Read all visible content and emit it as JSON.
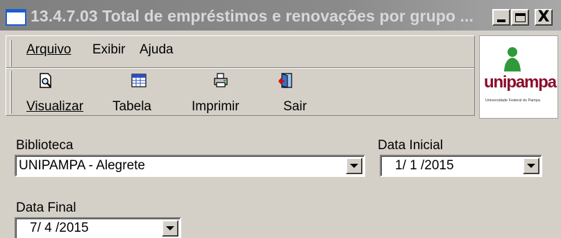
{
  "window": {
    "title": "13.4.7.03 Total de empréstimos e renovações por grupo ...",
    "controls": {
      "minimize": "minimize",
      "maximize": "maximize",
      "close": "X"
    }
  },
  "menu": {
    "items": [
      {
        "label": "Arquivo",
        "key": "A"
      },
      {
        "label": "Exibir",
        "key": "x"
      },
      {
        "label": "Ajuda",
        "key": "j"
      }
    ]
  },
  "toolbar": {
    "buttons": [
      {
        "label": "Visualizar",
        "icon": "preview-icon"
      },
      {
        "label": "Tabela",
        "icon": "table-icon"
      },
      {
        "label": "Imprimir",
        "icon": "printer-icon"
      },
      {
        "label": "Sair",
        "icon": "exit-icon"
      }
    ]
  },
  "logo": {
    "word": "unipampa",
    "subtitle": "Universidade Federal do Pampa"
  },
  "form": {
    "biblioteca": {
      "label": "Biblioteca",
      "value": "UNIPAMPA - Alegrete"
    },
    "data_inicial": {
      "label": "Data Inicial",
      "value": "1/ 1 /2015"
    },
    "data_final": {
      "label": "Data Final",
      "value": "7/ 4 /2015"
    }
  },
  "colors": {
    "face": "#d4d0c8",
    "title_gradient": "#808080",
    "logo_red": "#8a0c2a",
    "logo_green": "#2e9a3a"
  }
}
